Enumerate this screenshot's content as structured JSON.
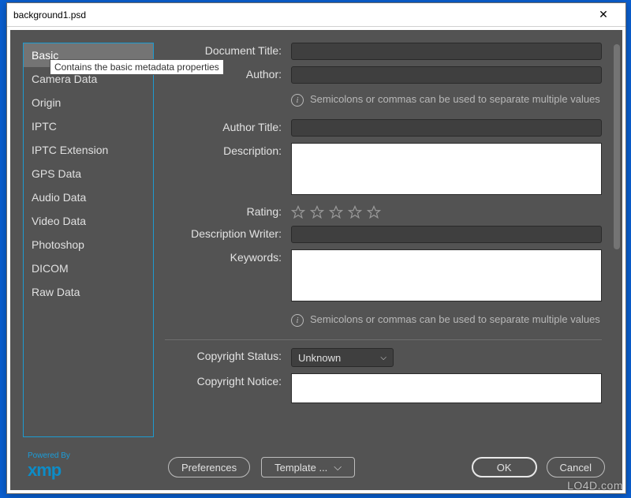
{
  "window": {
    "title": "background1.psd",
    "close_label": "✕"
  },
  "sidebar": {
    "items": [
      {
        "label": "Basic",
        "selected": true
      },
      {
        "label": "Camera Data"
      },
      {
        "label": "Origin"
      },
      {
        "label": "IPTC"
      },
      {
        "label": "IPTC Extension"
      },
      {
        "label": "GPS Data"
      },
      {
        "label": "Audio Data"
      },
      {
        "label": "Video Data"
      },
      {
        "label": "Photoshop"
      },
      {
        "label": "DICOM"
      },
      {
        "label": "Raw Data"
      }
    ],
    "tooltip": "Contains the basic metadata properties"
  },
  "form": {
    "document_title_label": "Document Title:",
    "document_title_value": "",
    "author_label": "Author:",
    "author_value": "",
    "author_hint": "Semicolons or commas can be used to separate multiple values",
    "author_title_label": "Author Title:",
    "author_title_value": "",
    "description_label": "Description:",
    "description_value": "",
    "rating_label": "Rating:",
    "rating_value": 0,
    "description_writer_label": "Description Writer:",
    "description_writer_value": "",
    "keywords_label": "Keywords:",
    "keywords_value": "",
    "keywords_hint": "Semicolons or commas can be used to separate multiple values",
    "copyright_status_label": "Copyright Status:",
    "copyright_status_value": "Unknown",
    "copyright_notice_label": "Copyright Notice:",
    "copyright_notice_value": ""
  },
  "footer": {
    "powered_by": "Powered By",
    "xmp": "xmp",
    "preferences": "Preferences",
    "template": "Template ...",
    "ok": "OK",
    "cancel": "Cancel"
  },
  "watermark": "LO4D.com"
}
